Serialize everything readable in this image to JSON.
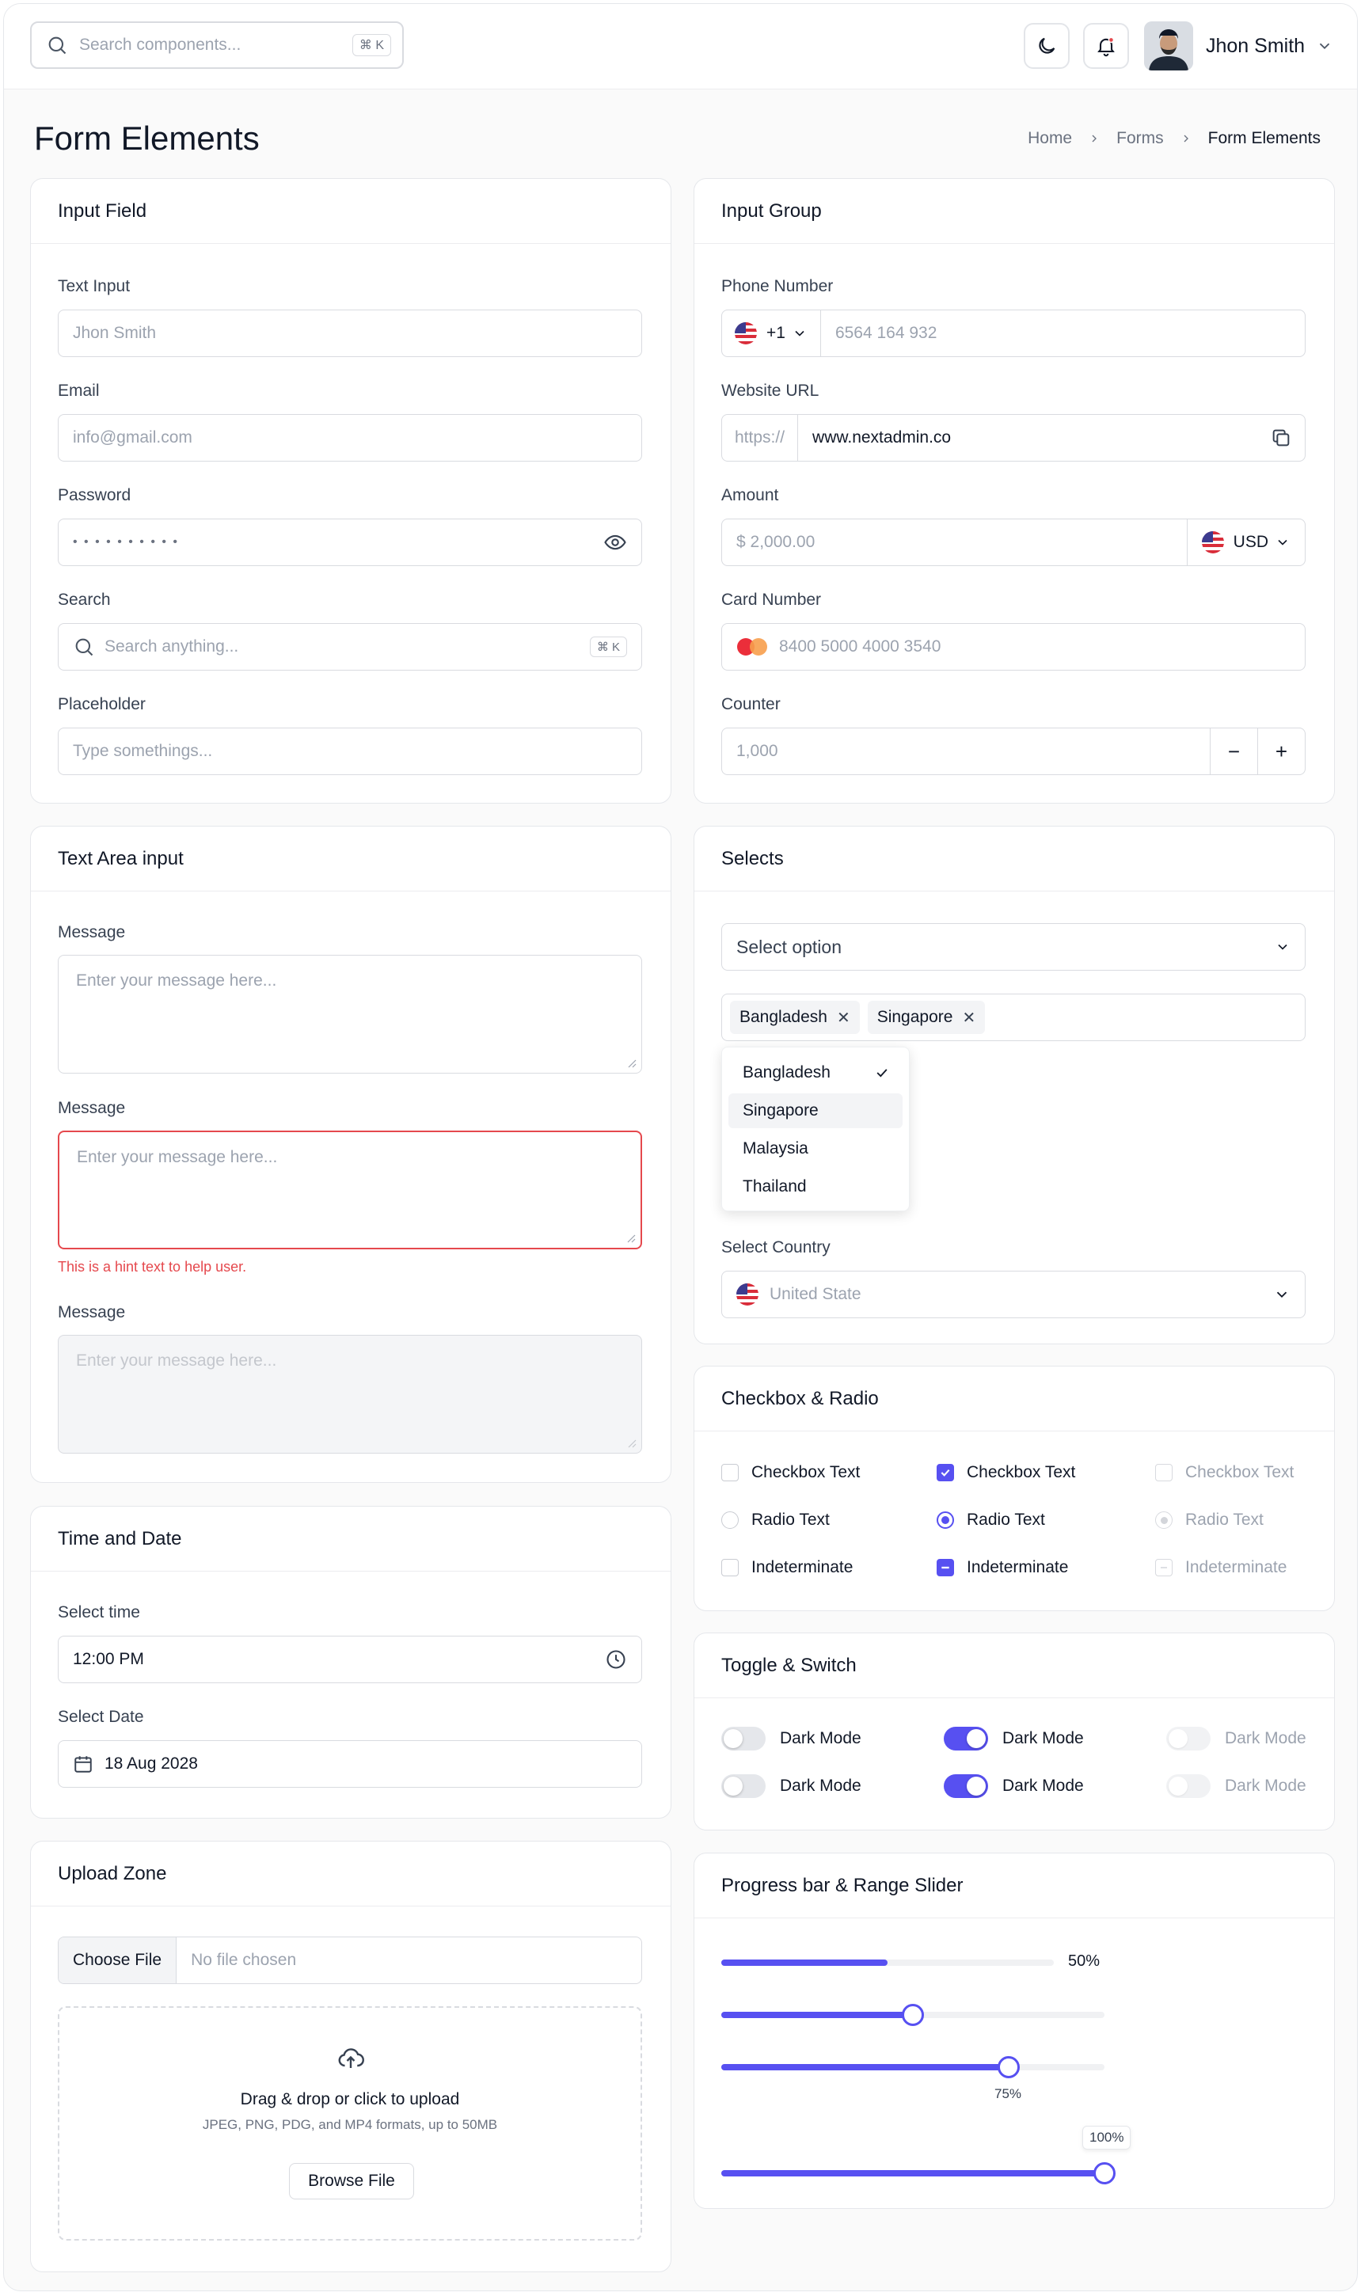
{
  "header": {
    "search_placeholder": "Search components...",
    "search_shortcut": "⌘ K",
    "user_name": "Jhon Smith"
  },
  "page": {
    "title": "Form Elements",
    "breadcrumb": [
      "Home",
      "Forms",
      "Form Elements"
    ]
  },
  "input_field": {
    "title": "Input Field",
    "text_label": "Text Input",
    "text_placeholder": "Jhon Smith",
    "email_label": "Email",
    "email_placeholder": "info@gmail.com",
    "password_label": "Password",
    "password_mask": "• • • • • • • • • •",
    "search_label": "Search",
    "search_placeholder": "Search anything...",
    "search_shortcut": "⌘ K",
    "placeholder_label": "Placeholder",
    "placeholder_text": "Type somethings..."
  },
  "input_group": {
    "title": "Input Group",
    "phone_label": "Phone Number",
    "phone_code": "+1",
    "phone_placeholder": "6564 164 932",
    "website_label": "Website URL",
    "website_prefix": "https://",
    "website_value": "www.nextadmin.co",
    "amount_label": "Amount",
    "amount_placeholder": "$  2,000.00",
    "currency": "USD",
    "card_label": "Card Number",
    "card_placeholder": "8400 5000 4000 3540",
    "counter_label": "Counter",
    "counter_placeholder": "1,000",
    "minus": "−",
    "plus": "+"
  },
  "textarea": {
    "title": "Text Area input",
    "label": "Message",
    "placeholder": "Enter your message here...",
    "hint": "This is a hint text to help user."
  },
  "selects": {
    "title": "Selects",
    "select_placeholder": "Select option",
    "tags": [
      "Bangladesh",
      "Singapore"
    ],
    "options": [
      "Bangladesh",
      "Singapore",
      "Malaysia",
      "Thailand"
    ],
    "country_label": "Select Country",
    "country_placeholder": "United State"
  },
  "checkbox_radio": {
    "title": "Checkbox & Radio",
    "checkbox_text": "Checkbox Text",
    "radio_text": "Radio Text",
    "indeterminate_text": "Indeterminate"
  },
  "time_date": {
    "title": "Time and Date",
    "time_label": "Select time",
    "time_value": "12:00 PM",
    "date_label": "Select Date",
    "date_value": "18 Aug 2028"
  },
  "toggle": {
    "title": "Toggle & Switch",
    "label": "Dark Mode"
  },
  "upload": {
    "title": "Upload Zone",
    "choose_file": "Choose File",
    "no_file": "No file chosen",
    "dz_title": "Drag & drop or click to upload",
    "dz_sub": "JPEG, PNG, PDG, and MP4 formats, up to 50MB",
    "browse": "Browse File"
  },
  "progress": {
    "title": "Progress bar & Range Slider",
    "progress_value": 0.5,
    "progress_label": "50%",
    "slider1_value": 0.5,
    "slider2_value": 0.75,
    "slider2_label": "75%",
    "slider3_value": 1.0,
    "slider3_label": "100%"
  },
  "colors": {
    "accent": "#5750f1",
    "error": "#e5484d"
  }
}
